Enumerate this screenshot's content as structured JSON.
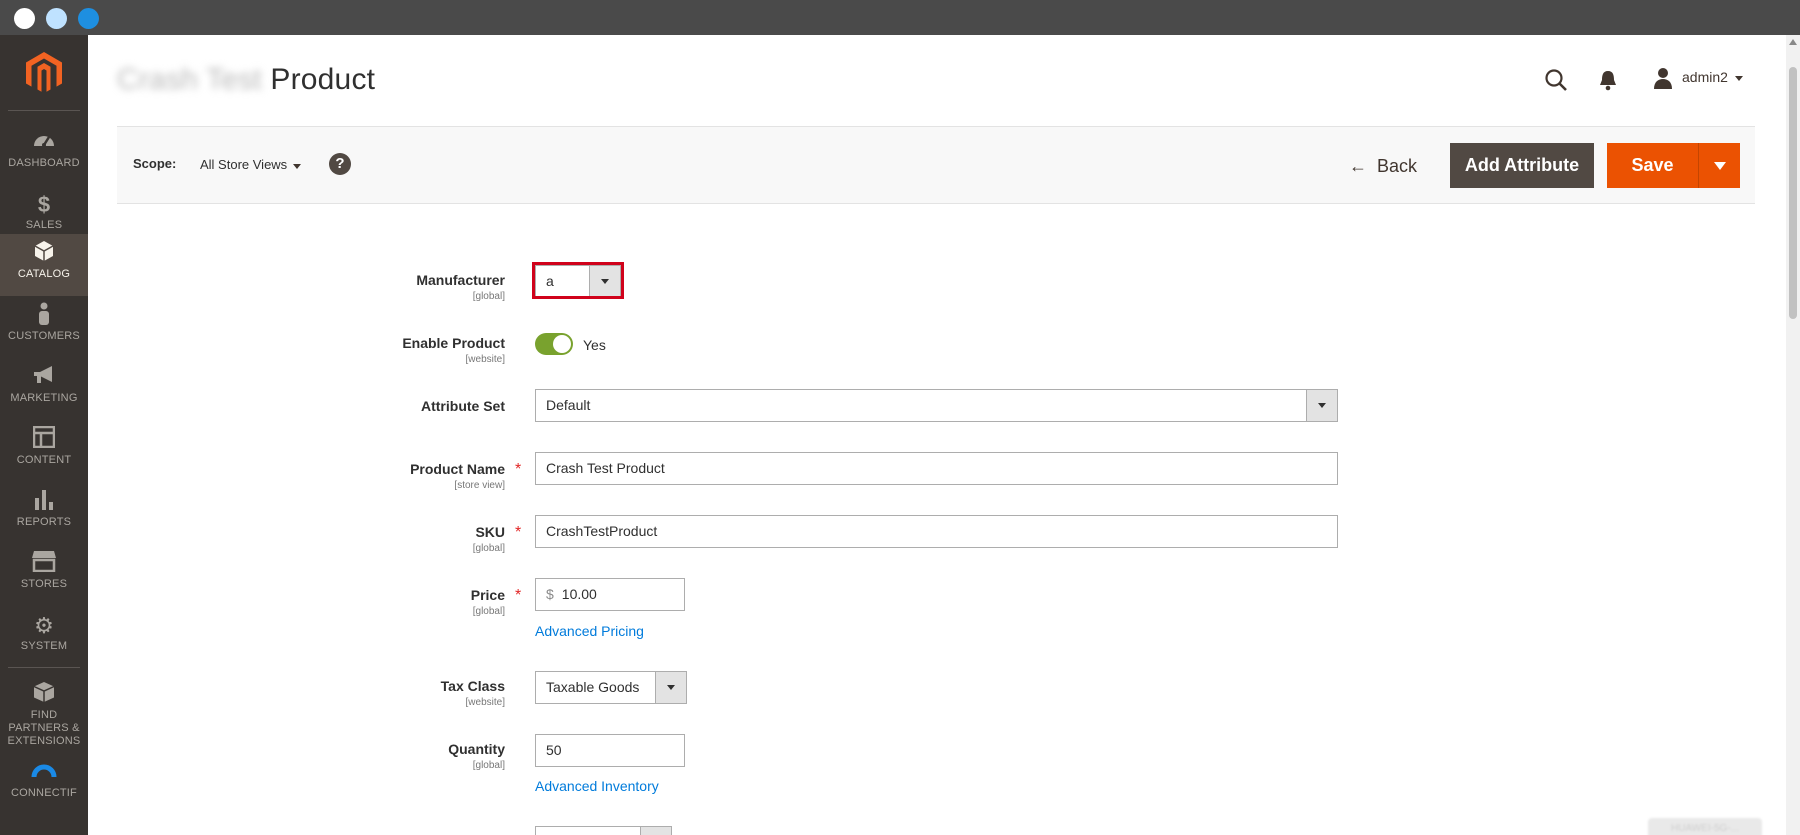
{
  "window": {
    "controls": [
      "close",
      "minimize",
      "zoom"
    ]
  },
  "sidebar": {
    "logo": "magento-logo",
    "items": [
      {
        "label": "DASHBOARD",
        "icon": "dashboard-icon",
        "active": false
      },
      {
        "label": "SALES",
        "icon": "dollar-icon",
        "active": false
      },
      {
        "label": "CATALOG",
        "icon": "cube-icon",
        "active": true
      },
      {
        "label": "CUSTOMERS",
        "icon": "person-icon",
        "active": false
      },
      {
        "label": "MARKETING",
        "icon": "megaphone-icon",
        "active": false
      },
      {
        "label": "CONTENT",
        "icon": "layout-icon",
        "active": false
      },
      {
        "label": "REPORTS",
        "icon": "bar-chart-icon",
        "active": false
      },
      {
        "label": "STORES",
        "icon": "store-icon",
        "active": false
      },
      {
        "label": "SYSTEM",
        "icon": "gear-icon",
        "active": false
      },
      {
        "label": "FIND PARTNERS & EXTENSIONS",
        "icon": "box-icon",
        "active": false
      },
      {
        "label": "CONNECTIF",
        "icon": "connectif-icon",
        "active": false
      }
    ]
  },
  "header": {
    "title_blurred": "Crash Test",
    "title": "Product",
    "user": "admin2",
    "icons": [
      "search-icon",
      "bell-icon",
      "user-icon"
    ]
  },
  "actions": {
    "scope_label": "Scope:",
    "scope_value": "All Store Views",
    "help": "?",
    "back": "Back",
    "add_attribute": "Add Attribute",
    "save": "Save"
  },
  "form": {
    "manufacturer": {
      "label": "Manufacturer",
      "scope": "[global]",
      "value": "a"
    },
    "enable_product": {
      "label": "Enable Product",
      "scope": "[website]",
      "value": "Yes",
      "enabled": true
    },
    "attribute_set": {
      "label": "Attribute Set",
      "value": "Default"
    },
    "product_name": {
      "label": "Product Name",
      "scope": "[store view]",
      "value": "Crash Test Product"
    },
    "sku": {
      "label": "SKU",
      "scope": "[global]",
      "value": "CrashTestProduct"
    },
    "price": {
      "label": "Price",
      "scope": "[global]",
      "currency": "$",
      "value": "10.00",
      "link": "Advanced Pricing"
    },
    "tax_class": {
      "label": "Tax Class",
      "scope": "[website]",
      "value": "Taxable Goods"
    },
    "quantity": {
      "label": "Quantity",
      "scope": "[global]",
      "value": "50",
      "link": "Advanced Inventory"
    }
  },
  "watermark": "HUAWEI-5G-..."
}
